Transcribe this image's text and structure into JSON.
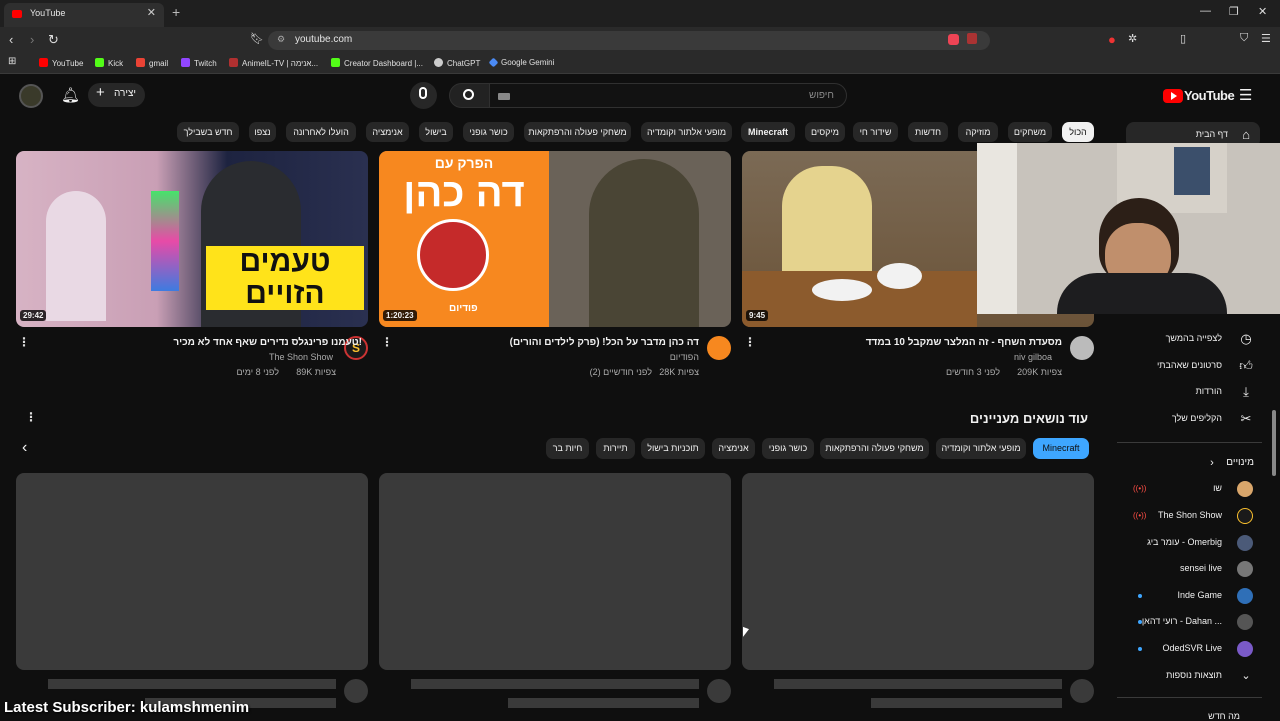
{
  "browser": {
    "tab_title": "YouTube",
    "url": "youtube.com",
    "bookmarks": [
      {
        "label": "YouTube",
        "color": "#ff0000"
      },
      {
        "label": "Kick",
        "color": "#53fc18"
      },
      {
        "label": "gmail",
        "color": "#ea4335"
      },
      {
        "label": "Twitch",
        "color": "#9146ff"
      },
      {
        "label": "AnimeIL-TV | אנימה...",
        "color": "#b03030"
      },
      {
        "label": "Creator Dashboard |...",
        "color": "#53fc18"
      },
      {
        "label": "ChatGPT",
        "color": "#cccccc"
      },
      {
        "label": "Google Gemini",
        "color": "#4b8bf5"
      }
    ]
  },
  "header": {
    "logo_text": "YouTube",
    "search_placeholder": "חיפוש",
    "create_label": "יצירה"
  },
  "chips": [
    {
      "label": "הכול",
      "active": true
    },
    {
      "label": "משחקים"
    },
    {
      "label": "מוזיקה"
    },
    {
      "label": "חדשות"
    },
    {
      "label": "שידור חי"
    },
    {
      "label": "מיקסים"
    },
    {
      "label": "Minecraft"
    },
    {
      "label": "מופעי אלתור וקומדיה"
    },
    {
      "label": "משחקי פעולה והרפתקאות"
    },
    {
      "label": "כושר גופני"
    },
    {
      "label": "בישול"
    },
    {
      "label": "אנימציה"
    },
    {
      "label": "הועלו לאחרונה"
    },
    {
      "label": "נצפו"
    },
    {
      "label": "חדש בשבילך"
    }
  ],
  "videos": [
    {
      "title": "טעמנו פרינגלס נדירים שאף אחד לא מכיר!",
      "channel": "The Shon Show",
      "views": "89K צפיות",
      "age": "לפני 8 ימים",
      "duration": "29:42",
      "thumb_text": "טעמים הזויים"
    },
    {
      "title": "דה כהן מדבר על הכל! (פרק לילדים והורים)",
      "channel": "הפודיום",
      "views": "28K צפיות",
      "age": "לפני חודשיים (2)",
      "duration": "1:20:23",
      "thumb_text_top": "הפרק עם",
      "thumb_text_main": "דה כהן",
      "thumb_brand": "פודיום"
    },
    {
      "title": "מסעדת השחף - זה המלצר שמקבל 10 במדד",
      "channel": "niv gilboa",
      "views": "209K צפיות",
      "age": "לפני 3 חודשים",
      "duration": "9:45"
    }
  ],
  "topics": {
    "title": "עוד נושאים מעניינים",
    "chips": [
      {
        "label": "Minecraft",
        "active": true
      },
      {
        "label": "מופעי אלתור וקומדיה"
      },
      {
        "label": "משחקי פעולה והרפתקאות"
      },
      {
        "label": "כושר גופני"
      },
      {
        "label": "אנימציה"
      },
      {
        "label": "תוכניות בישול"
      },
      {
        "label": "תיירות"
      },
      {
        "label": "חיות בר"
      }
    ]
  },
  "sidebar": {
    "home": "דף הבית",
    "items": [
      {
        "label": "לצפייה בהמשך",
        "icon": "clock-icon"
      },
      {
        "label": "סרטונים שאהבתי",
        "icon": "thumbs-up-icon"
      },
      {
        "label": "הורדות",
        "icon": "download-icon"
      },
      {
        "label": "הקליפים שלך",
        "icon": "scissors-icon"
      }
    ],
    "subs_title": "מינויים",
    "subs": [
      {
        "name": "שו",
        "status": "live",
        "color": "#d9a66b"
      },
      {
        "name": "The Shon Show",
        "status": "live",
        "color": "#1a1a1a"
      },
      {
        "name": "עומר ביג - Omerbig",
        "status": "",
        "color": "#4b5a78"
      },
      {
        "name": "sensei live",
        "status": "",
        "color": "#777777"
      },
      {
        "name": "Inde Game",
        "status": "new",
        "color": "#2f6fb7"
      },
      {
        "name": "רועי דהאן - Dahan ...",
        "status": "new",
        "color": "#555555"
      },
      {
        "name": "OdedSVR Live",
        "status": "new",
        "color": "#7a5ac8"
      }
    ],
    "show_more": "תוצאות נוספות",
    "bottom_cut": "מה חדש"
  },
  "overlay": {
    "text": "Latest Subscriber: kulamshmenim"
  }
}
